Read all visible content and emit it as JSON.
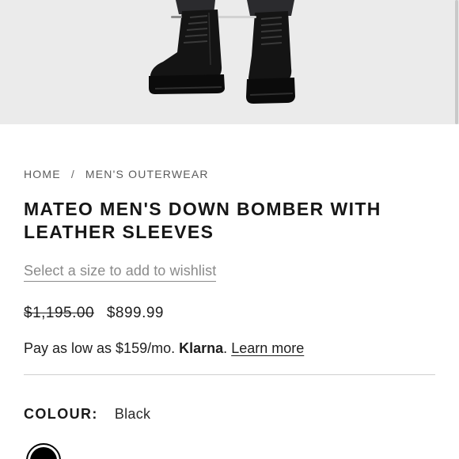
{
  "breadcrumb": {
    "home": "HOME",
    "separator": "/",
    "category": "MEN'S OUTERWEAR"
  },
  "product": {
    "title": "MATEO MEN'S DOWN BOMBER WITH LEATHER SLEEVES",
    "wishlist_prompt": "Select a size to add to wishlist",
    "price_original": "$1,195.00",
    "price_sale": "$899.99"
  },
  "financing": {
    "text": "Pay as low as $159/mo.",
    "provider": "Klarna",
    "punctuation": ".",
    "learn_more": "Learn more"
  },
  "colour": {
    "label": "COLOUR:",
    "value": "Black",
    "swatch_color": "#000000"
  },
  "gallery": {
    "active_image": 1,
    "image_background": "#ebebeb"
  }
}
